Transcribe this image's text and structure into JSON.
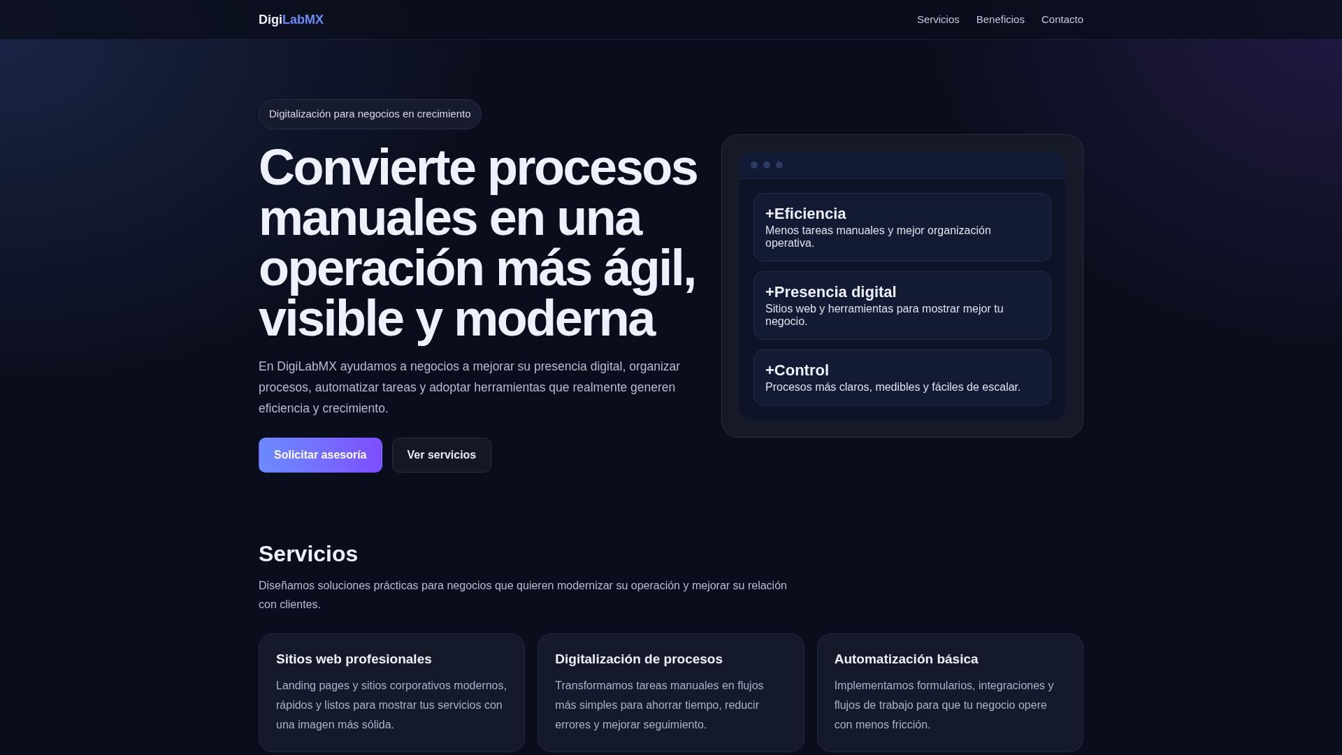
{
  "header": {
    "logo": {
      "part1": "Digi",
      "part2": "LabMX"
    },
    "nav": [
      "Servicios",
      "Beneficios",
      "Contacto"
    ]
  },
  "hero": {
    "badge": "Digitalización para negocios en crecimiento",
    "title": "Convierte procesos manuales en una operación más ágil, visible y moderna",
    "text": "En DigiLabMX ayudamos a negocios a mejorar su presencia digital, organizar procesos, automatizar tareas y adoptar herramientas que realmente generen eficiencia y crecimiento.",
    "buttons": [
      {
        "label": "Solicitar asesoría",
        "kind": "primary"
      },
      {
        "label": "Ver servicios",
        "kind": "secondary"
      }
    ]
  },
  "preview": {
    "items": [
      {
        "title": "+Eficiencia",
        "text": "Menos tareas manuales y mejor organización operativa."
      },
      {
        "title": "+Presencia digital",
        "text": "Sitios web y herramientas para mostrar mejor tu negocio."
      },
      {
        "title": "+Control",
        "text": "Procesos más claros, medibles y fáciles de escalar."
      }
    ]
  },
  "services": {
    "title": "Servicios",
    "text": "Diseñamos soluciones prácticas para negocios que quieren modernizar su operación y mejorar su relación con clientes.",
    "cards": [
      {
        "title": "Sitios web profesionales",
        "text": "Landing pages y sitios corporativos modernos, rápidos y listos para mostrar tus servicios con una imagen más sólida."
      },
      {
        "title": "Digitalización de procesos",
        "text": "Transformamos tareas manuales en flujos más simples para ahorrar tiempo, reducir errores y mejorar seguimiento."
      },
      {
        "title": "Automatización básica",
        "text": "Implementamos formularios, integraciones y flujos de trabajo para que tu negocio opere con menos fricción."
      }
    ]
  }
}
